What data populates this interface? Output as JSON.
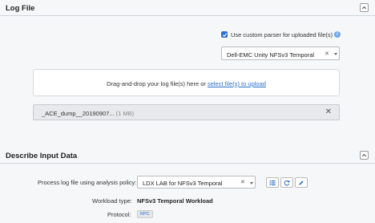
{
  "log_file_section": {
    "title": "Log File",
    "custom_parser": {
      "label": "Use custom parser for uploaded file(s)",
      "checked": true
    },
    "parser_select": {
      "value": "Dell-EMC Unity NFSv3 Temporal"
    },
    "dropzone": {
      "text": "Drag-and-drop your log file(s) here or ",
      "link": "select file(s) to upload"
    },
    "file": {
      "name": "_ACE_dump__20190907...",
      "size": "(1 MB)"
    }
  },
  "describe_section": {
    "title": "Describe Input Data",
    "policy": {
      "label": "Process log file using analysis policy:",
      "value": "LDX LAB for NFSv3 Temporal"
    },
    "workload": {
      "label": "Workload type:",
      "value": "NFSv3 Temporal Workload"
    },
    "protocol": {
      "label": "Protocol:",
      "value": "RPC"
    }
  },
  "icons": {
    "collapse": "chevron-up-icon",
    "info": "info-icon",
    "clear": "close-icon",
    "list": "list-icon",
    "refresh": "refresh-icon",
    "edit": "pencil-icon"
  },
  "colors": {
    "accent": "#2f6fd1",
    "link": "#2a6fc9",
    "info": "#6fa8e8"
  }
}
